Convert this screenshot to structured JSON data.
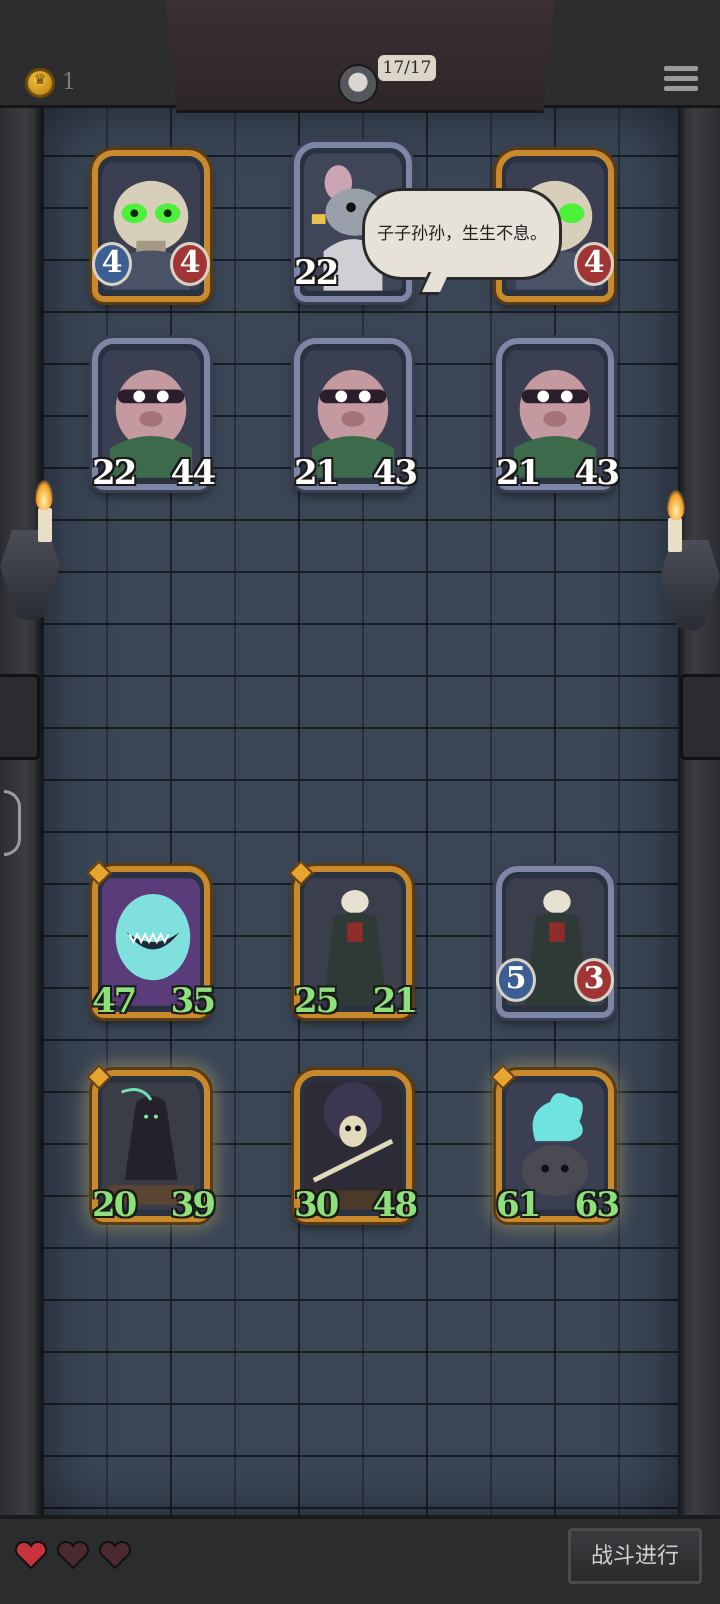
{
  "header": {
    "coins": "1",
    "hp_text": "17/17"
  },
  "dialog": {
    "speech": "子子孙孙，生生不息。"
  },
  "enemy_row1": [
    {
      "name": "skull-spider",
      "atk": "4",
      "hp": "4"
    },
    {
      "name": "rat-boss",
      "atk": "22",
      "hp": ""
    },
    {
      "name": "skull-spider",
      "atk": "",
      "hp": "4"
    }
  ],
  "enemy_row2": [
    {
      "name": "masked-pig",
      "atk": "22",
      "hp": "44"
    },
    {
      "name": "masked-pig",
      "atk": "21",
      "hp": "43"
    },
    {
      "name": "masked-pig",
      "atk": "21",
      "hp": "43"
    }
  ],
  "player_row1": [
    {
      "name": "ghost-maw",
      "atk": "47",
      "hp": "35"
    },
    {
      "name": "skull-necromancer",
      "atk": "25",
      "hp": "21"
    },
    {
      "name": "skull-necromancer",
      "atk": "5",
      "hp": "3"
    }
  ],
  "player_row2": [
    {
      "name": "ferryman-reaper",
      "atk": "20",
      "hp": "39"
    },
    {
      "name": "skeleton-rower",
      "atk": "30",
      "hp": "48"
    },
    {
      "name": "soul-cauldron",
      "atk": "61",
      "hp": "63"
    }
  ],
  "footer": {
    "lives_total": 3,
    "lives_remaining": 1,
    "battle_label": "战斗进行"
  },
  "colors": {
    "gold_frame": "#c98a2e",
    "silver_frame": "#7e86a6",
    "atk_badge": "#3b5e93",
    "hp_badge": "#a13434",
    "buff_stat": "#8ee07a",
    "heart_full": "#c8343c",
    "heart_empty": "#4a2a2e"
  }
}
